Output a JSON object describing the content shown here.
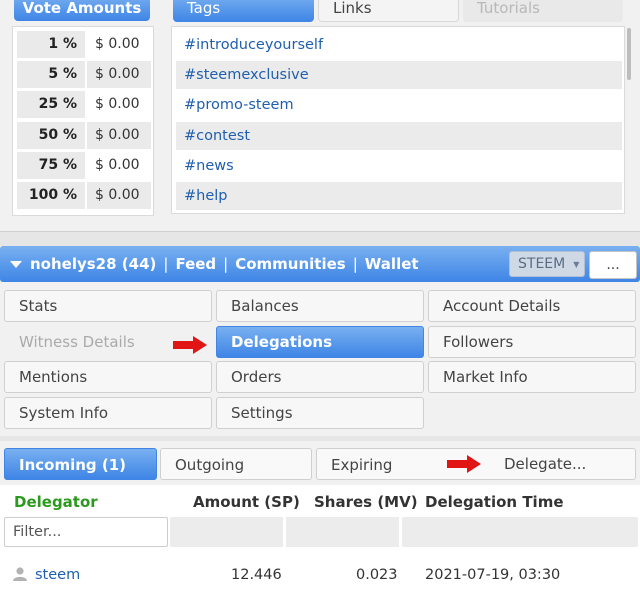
{
  "vote_amounts": {
    "header": "Vote Amounts",
    "rows": [
      {
        "pct": "1 %",
        "amount": "$ 0.00"
      },
      {
        "pct": "5 %",
        "amount": "$ 0.00"
      },
      {
        "pct": "25 %",
        "amount": "$ 0.00"
      },
      {
        "pct": "50 %",
        "amount": "$ 0.00"
      },
      {
        "pct": "75 %",
        "amount": "$ 0.00"
      },
      {
        "pct": "100 %",
        "amount": "$ 0.00"
      }
    ]
  },
  "top_tabs": {
    "tags": "Tags",
    "links": "Links",
    "tutorials": "Tutorials"
  },
  "tags": [
    "#introduceyourself",
    "#steemexclusive",
    "#promo-steem",
    "#contest",
    "#news",
    "#help"
  ],
  "account_bar": {
    "account": "nohelys28 (44)",
    "separator": "|",
    "feed": "Feed",
    "communities": "Communities",
    "wallet": "Wallet",
    "currency": "STEEM",
    "more": "..."
  },
  "menu": {
    "stats": "Stats",
    "balances": "Balances",
    "account_details": "Account Details",
    "witness_details": "Witness Details",
    "delegations": "Delegations",
    "followers": "Followers",
    "mentions": "Mentions",
    "orders": "Orders",
    "market_info": "Market Info",
    "system_info": "System Info",
    "settings": "Settings"
  },
  "delegation_tabs": {
    "incoming": "Incoming (1)",
    "outgoing": "Outgoing",
    "expiring": "Expiring",
    "delegate": "Delegate..."
  },
  "table": {
    "headers": {
      "delegator": "Delegator",
      "amount": "Amount (SP)",
      "shares": "Shares (MV)",
      "time": "Delegation Time"
    },
    "filter_placeholder": "Filter...",
    "rows": [
      {
        "delegator": "steem",
        "amount": "12.446",
        "shares": "0.023",
        "time": "2021-07-19, 03:30"
      }
    ]
  },
  "colors": {
    "accent_blue": "#3e85e6",
    "link_blue": "#1f5fae",
    "delegator_green": "#2c9a1e",
    "arrow_red": "#e11515"
  }
}
